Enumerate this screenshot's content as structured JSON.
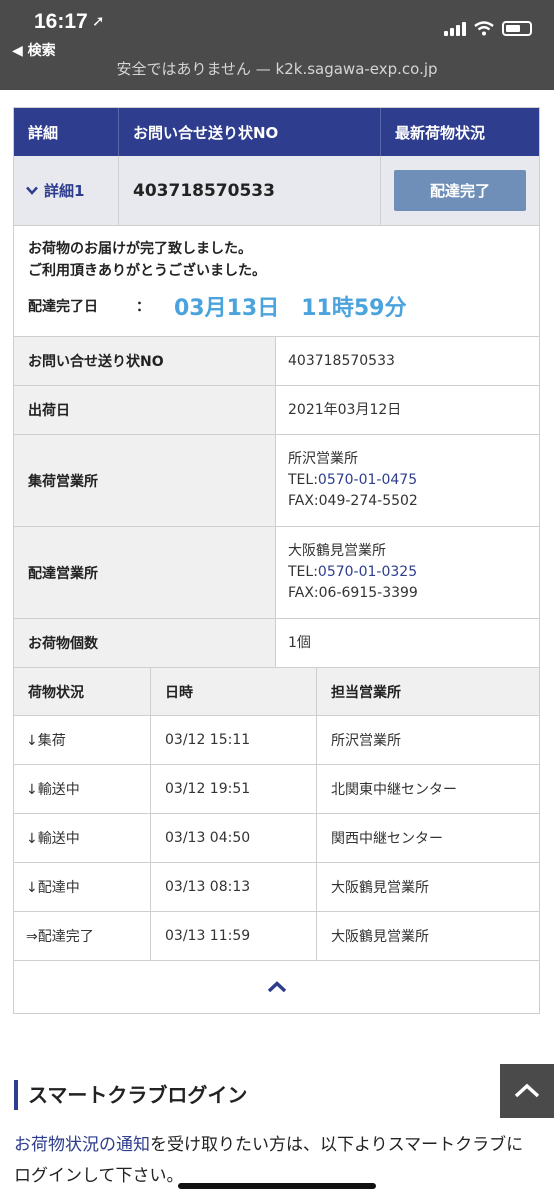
{
  "status": {
    "time": "16:17",
    "back_label": "◀ 検索",
    "url_text": "安全ではありません — k2k.sagawa-exp.co.jp"
  },
  "table": {
    "headers": [
      "詳細",
      "お問い合せ送り状NO",
      "最新荷物状況"
    ],
    "detail_label": "詳細1",
    "tracking_no": "403718570533",
    "status_button": "配達完了"
  },
  "message": {
    "line1": "お荷物のお届けが完了致しました。",
    "line2": "ご利用頂きありがとうございました。",
    "date_label": "配達完了日",
    "date_colon": "：",
    "date_value": "03月13日　11時59分"
  },
  "info": {
    "tracking_label": "お問い合せ送り状NO",
    "tracking_value": "403718570533",
    "ship_label": "出荷日",
    "ship_value": "2021年03月12日",
    "pickup_label": "集荷営業所",
    "pickup_name": "所沢営業所",
    "pickup_tel_prefix": "TEL:",
    "pickup_tel": "0570-01-0475",
    "pickup_fax": "FAX:049-274-5502",
    "delivery_label": "配達営業所",
    "delivery_name": "大阪鶴見営業所",
    "delivery_tel_prefix": "TEL:",
    "delivery_tel": "0570-01-0325",
    "delivery_fax": "FAX:06-6915-3399",
    "count_label": "お荷物個数",
    "count_value": "1個"
  },
  "tracking": {
    "headers": [
      "荷物状況",
      "日時",
      "担当営業所"
    ],
    "rows": [
      {
        "status": "↓集荷",
        "time": "03/12 15:11",
        "office": "所沢営業所"
      },
      {
        "status": "↓輸送中",
        "time": "03/12 19:51",
        "office": "北関東中継センター"
      },
      {
        "status": "↓輸送中",
        "time": "03/13 04:50",
        "office": "関西中継センター"
      },
      {
        "status": "↓配達中",
        "time": "03/13 08:13",
        "office": "大阪鶴見営業所"
      },
      {
        "status": "⇒配達完了",
        "time": "03/13 11:59",
        "office": "大阪鶴見営業所"
      }
    ]
  },
  "smart_club": {
    "title": "スマートクラブログイン",
    "link_text": "お荷物状況の通知",
    "body_text": "を受け取りたい方は、以下よりスマートクラブにログインして下さい。"
  },
  "icons": {
    "location": "location-arrow-icon",
    "collapse": "chevron-up-icon",
    "scroll_top": "chevron-up-icon",
    "detail": "chevron-down-icon"
  },
  "colors": {
    "header_navy": "#2e3d8e",
    "button_blue": "#6f8fb8",
    "date_blue": "#4aa3dc"
  }
}
